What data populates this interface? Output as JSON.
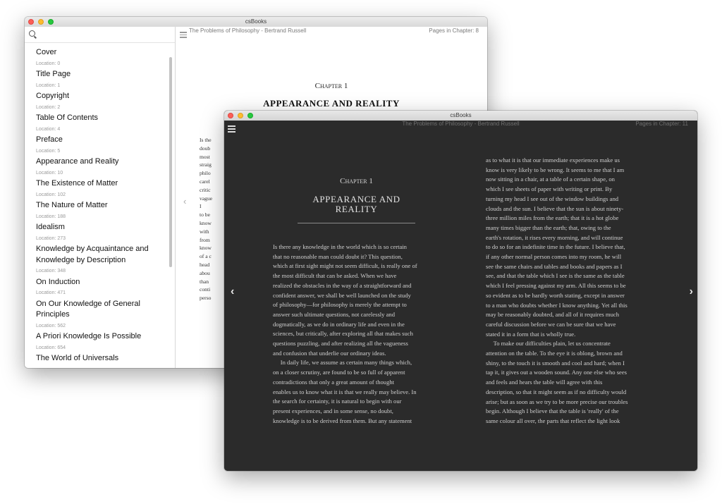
{
  "app_title": "csBooks",
  "book_header": "The Problems of Philosophy - Bertrand Russell",
  "light_window": {
    "pages_in_chapter": "Pages in Chapter: 8",
    "chapter_label": "Chapter 1",
    "chapter_title": "APPEARANCE AND REALITY",
    "text_fragments": [
      "Is the",
      "doub",
      "most",
      "straig",
      "philo",
      "carel",
      "critic",
      "vague",
      "I",
      "to be",
      "know",
      "with",
      "from",
      "know",
      "of a c",
      "head",
      "abou",
      "than",
      "conti",
      "perso"
    ]
  },
  "toc": [
    {
      "title": "Cover",
      "location": "Location: 0"
    },
    {
      "title": "Title Page",
      "location": "Location: 1"
    },
    {
      "title": "Copyright",
      "location": "Location: 2"
    },
    {
      "title": "Table Of Contents",
      "location": "Location: 4"
    },
    {
      "title": "Preface",
      "location": "Location: 5"
    },
    {
      "title": "Appearance and Reality",
      "location": "Location: 10"
    },
    {
      "title": "The Existence of Matter",
      "location": "Location: 102"
    },
    {
      "title": "The Nature of Matter",
      "location": "Location: 188"
    },
    {
      "title": "Idealism",
      "location": "Location: 273"
    },
    {
      "title": "Knowledge by Acquaintance and\nKnowledge by Description",
      "location": "Location: 348"
    },
    {
      "title": "On Induction",
      "location": "Location: 471"
    },
    {
      "title": "On Our Knowledge of General\nPrinciples",
      "location": "Location: 562"
    },
    {
      "title": "A Priori Knowledge Is Possible",
      "location": "Location: 654"
    },
    {
      "title": "The World of Universals",
      "location": ""
    }
  ],
  "dark_window": {
    "pages_in_chapter": "Pages in Chapter: 11",
    "chapter_label": "Chapter 1",
    "chapter_title": "APPEARANCE AND\nREALITY",
    "left_column": "Is there any knowledge in the world which is so certain\nthat no reasonable man could doubt it? This question,\nwhich at first sight might not seem difficult, is really one of\nthe most difficult that can be asked. When we have\nrealized the obstacles in the way of a straightforward and\nconfident answer, we shall be well launched on the study\nof philosophy—for philosophy is merely the attempt to\nanswer such ultimate questions, not carelessly and\ndogmatically, as we do in ordinary life and even in the\nsciences, but critically, after exploring all that makes such\nquestions puzzling, and after realizing all the vagueness\nand confusion that underlie our ordinary ideas.\n     In daily life, we assume as certain many things which,\non a closer scrutiny, are found to be so full of apparent\ncontradictions that only a great amount of thought\nenables us to know what it is that we really may believe. In\nthe search for certainty, it is natural to begin with our\npresent experiences, and in some sense, no doubt,\nknowledge is to be derived from them. But any statement",
    "right_column": "as to what it is that our immediate experiences make us\nknow is very likely to be wrong. It seems to me that I am\nnow sitting in a chair, at a table of a certain shape, on\nwhich I see sheets of paper with writing or print. By\nturning my head I see out of the window buildings and\nclouds and the sun. I believe that the sun is about ninety-\nthree million miles from the earth; that it is a hot globe\nmany times bigger than the earth; that, owing to the\nearth's rotation, it rises every morning, and will continue\nto do so for an indefinite time in the future. I believe that,\nif any other normal person comes into my room, he will\nsee the same chairs and tables and books and papers as I\nsee, and that the table which I see is the same as the table\nwhich I feel pressing against my arm. All this seems to be\nso evident as to be hardly worth stating, except in answer\nto a man who doubts whether I know anything. Yet all this\nmay be reasonably doubted, and all of it requires much\ncareful discussion before we can be sure that we have\nstated it in a form that is wholly true.\n     To make our difficulties plain, let us concentrate\nattention on the table. To the eye it is oblong, brown and\nshiny, to the touch it is smooth and cool and hard; when I\ntap it, it gives out a wooden sound. Any one else who sees\nand feels and hears the table will agree with this\ndescription, so that it might seem as if no difficulty would\narise; but as soon as we try to be more precise our troubles\nbegin. Although I believe that the table is 'really' of the\nsame colour all over, the parts that reflect the light look"
  },
  "icons": {
    "search": "search-icon",
    "menu": "hamburger-menu-icon",
    "prev": "chevron-left-icon",
    "next": "chevron-right-icon"
  },
  "colors": {
    "dark_bg": "#2b2b2b",
    "light_bg": "#ffffff",
    "close": "#fc5f57",
    "minimize": "#fdbc2e",
    "zoom": "#28c840"
  }
}
